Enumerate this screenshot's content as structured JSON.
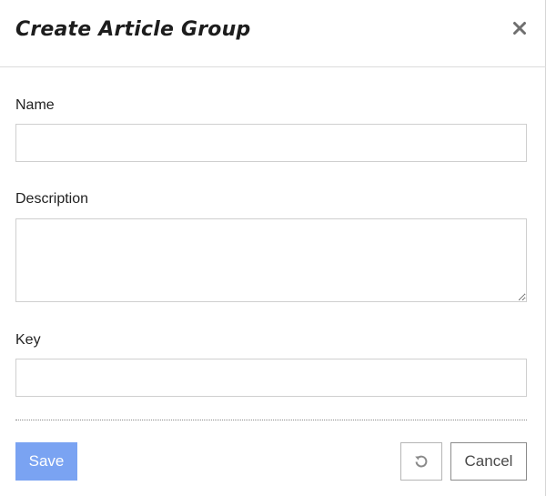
{
  "dialog": {
    "title": "Create Article Group"
  },
  "form": {
    "name_label": "Name",
    "name_value": "",
    "description_label": "Description",
    "description_value": "",
    "key_label": "Key",
    "key_value": ""
  },
  "footer": {
    "save_label": "Save",
    "cancel_label": "Cancel"
  },
  "icons": {
    "close": "close-icon",
    "reset": "undo-icon"
  },
  "colors": {
    "save_button": "#7aa3f2",
    "title_text": "#1d1d1d"
  }
}
